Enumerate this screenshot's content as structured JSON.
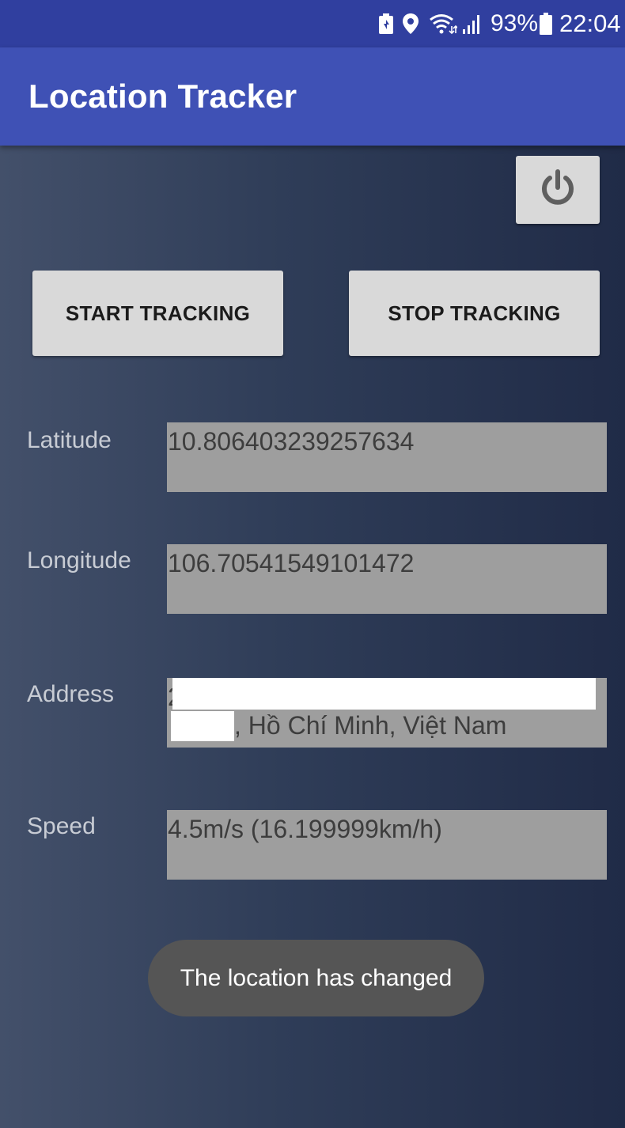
{
  "status_bar": {
    "battery_percent": "93%",
    "time": "22:04",
    "icons": [
      "battery-saver-icon",
      "location-icon",
      "wifi-icon",
      "signal-icon",
      "battery-icon"
    ]
  },
  "app": {
    "title": "Location Tracker"
  },
  "controls": {
    "power_icon": "power-icon",
    "start_label": "START TRACKING",
    "stop_label": "STOP TRACKING"
  },
  "fields": {
    "latitude": {
      "label": "Latitude",
      "value": "10.806403239257634"
    },
    "longitude": {
      "label": "Longitude",
      "value": "106.70541549101472"
    },
    "address": {
      "label": "Address",
      "line1": "2",
      "line2": ", Hồ Chí Minh, Việt Nam"
    },
    "speed": {
      "label": "Speed",
      "value": "4.5m/s (16.199999km/h)"
    }
  },
  "toast": {
    "message": "The location has changed"
  },
  "colors": {
    "status_bar": "#303f9f",
    "app_bar": "#3f51b5",
    "button": "#d9d9d9",
    "field_bg": "#9e9e9e",
    "toast_bg": "#555555"
  }
}
